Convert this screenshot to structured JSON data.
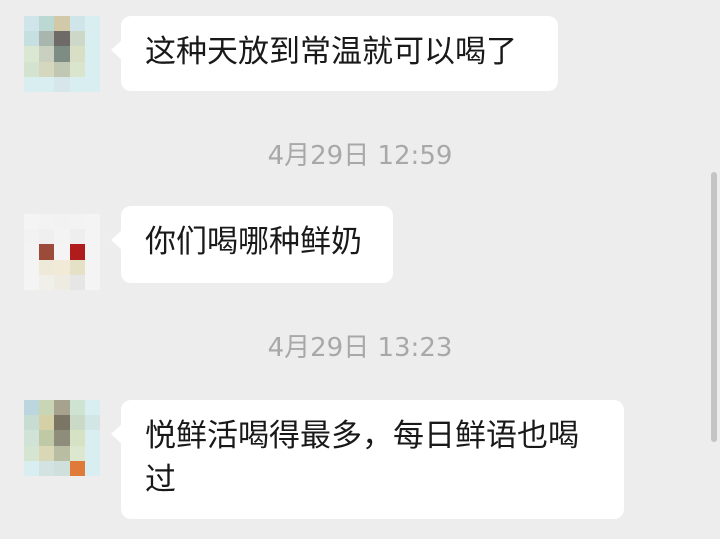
{
  "messages": [
    {
      "text": "这种天放到常温就可以喝了"
    },
    {
      "text": "你们喝哪种鲜奶"
    },
    {
      "text": "悦鲜活喝得最多，每日鲜语也喝过"
    }
  ],
  "timestamps": [
    "4月29日 12:59",
    "4月29日 13:23"
  ],
  "avatars": [
    {
      "icon": "pixelated-avatar-icon",
      "colors": [
        "#cfe5ea",
        "#bcd8d3",
        "#d2c9a9",
        "#cfe5ea",
        "#d9eef1",
        "#c6dfe1",
        "#a9b6ae",
        "#6e6a68",
        "#cdd8c8",
        "#d9eef1",
        "#d9e7d3",
        "#cad0bf",
        "#7d8d84",
        "#d8dfc4",
        "#d9eef1",
        "#d3e3d0",
        "#d6d7bf",
        "#c0c8b3",
        "#dbe5ce",
        "#d9eef1",
        "#d9eef1",
        "#d9eef1",
        "#d6e6ea",
        "#d9eef1",
        "#d9eef1"
      ]
    },
    {
      "icon": "pixelated-avatar-icon",
      "colors": [
        "#f4f4f4",
        "#f3f3f3",
        "#f2f2f2",
        "#f3f3f3",
        "#f4f4f4",
        "#f2f2f2",
        "#efefef",
        "#f3f3f3",
        "#eeeeee",
        "#f4f4f4",
        "#f3f3f3",
        "#9c4a3a",
        "#f4f4f4",
        "#b01c1c",
        "#f4f4f4",
        "#f4f4f4",
        "#efe9da",
        "#f0ead7",
        "#e5e1c6",
        "#f4f4f4",
        "#f4f4f4",
        "#f1efe9",
        "#eeebe3",
        "#e6e6e6",
        "#f4f4f4"
      ]
    },
    {
      "icon": "pixelated-avatar-icon",
      "colors": [
        "#bcd6df",
        "#c9d6b6",
        "#a7a28e",
        "#cfe3d3",
        "#d9eef1",
        "#c7dcd2",
        "#d6d0a6",
        "#7b7566",
        "#cbdac7",
        "#d3e6e6",
        "#d0e3d6",
        "#bfc9a6",
        "#8e8d7c",
        "#d7e2c5",
        "#d9eef1",
        "#d5e5d2",
        "#d9d7b5",
        "#b9bda2",
        "#dde6cf",
        "#d9eef1",
        "#d9eef1",
        "#d3e3e2",
        "#cfe0dc",
        "#e07a38",
        "#d9eef1"
      ]
    }
  ],
  "colors": {
    "background": "#ededed",
    "bubble": "#ffffff",
    "text": "#191919",
    "timestamp": "#a8a8a8",
    "scrollbar": "#c4c4c4"
  }
}
